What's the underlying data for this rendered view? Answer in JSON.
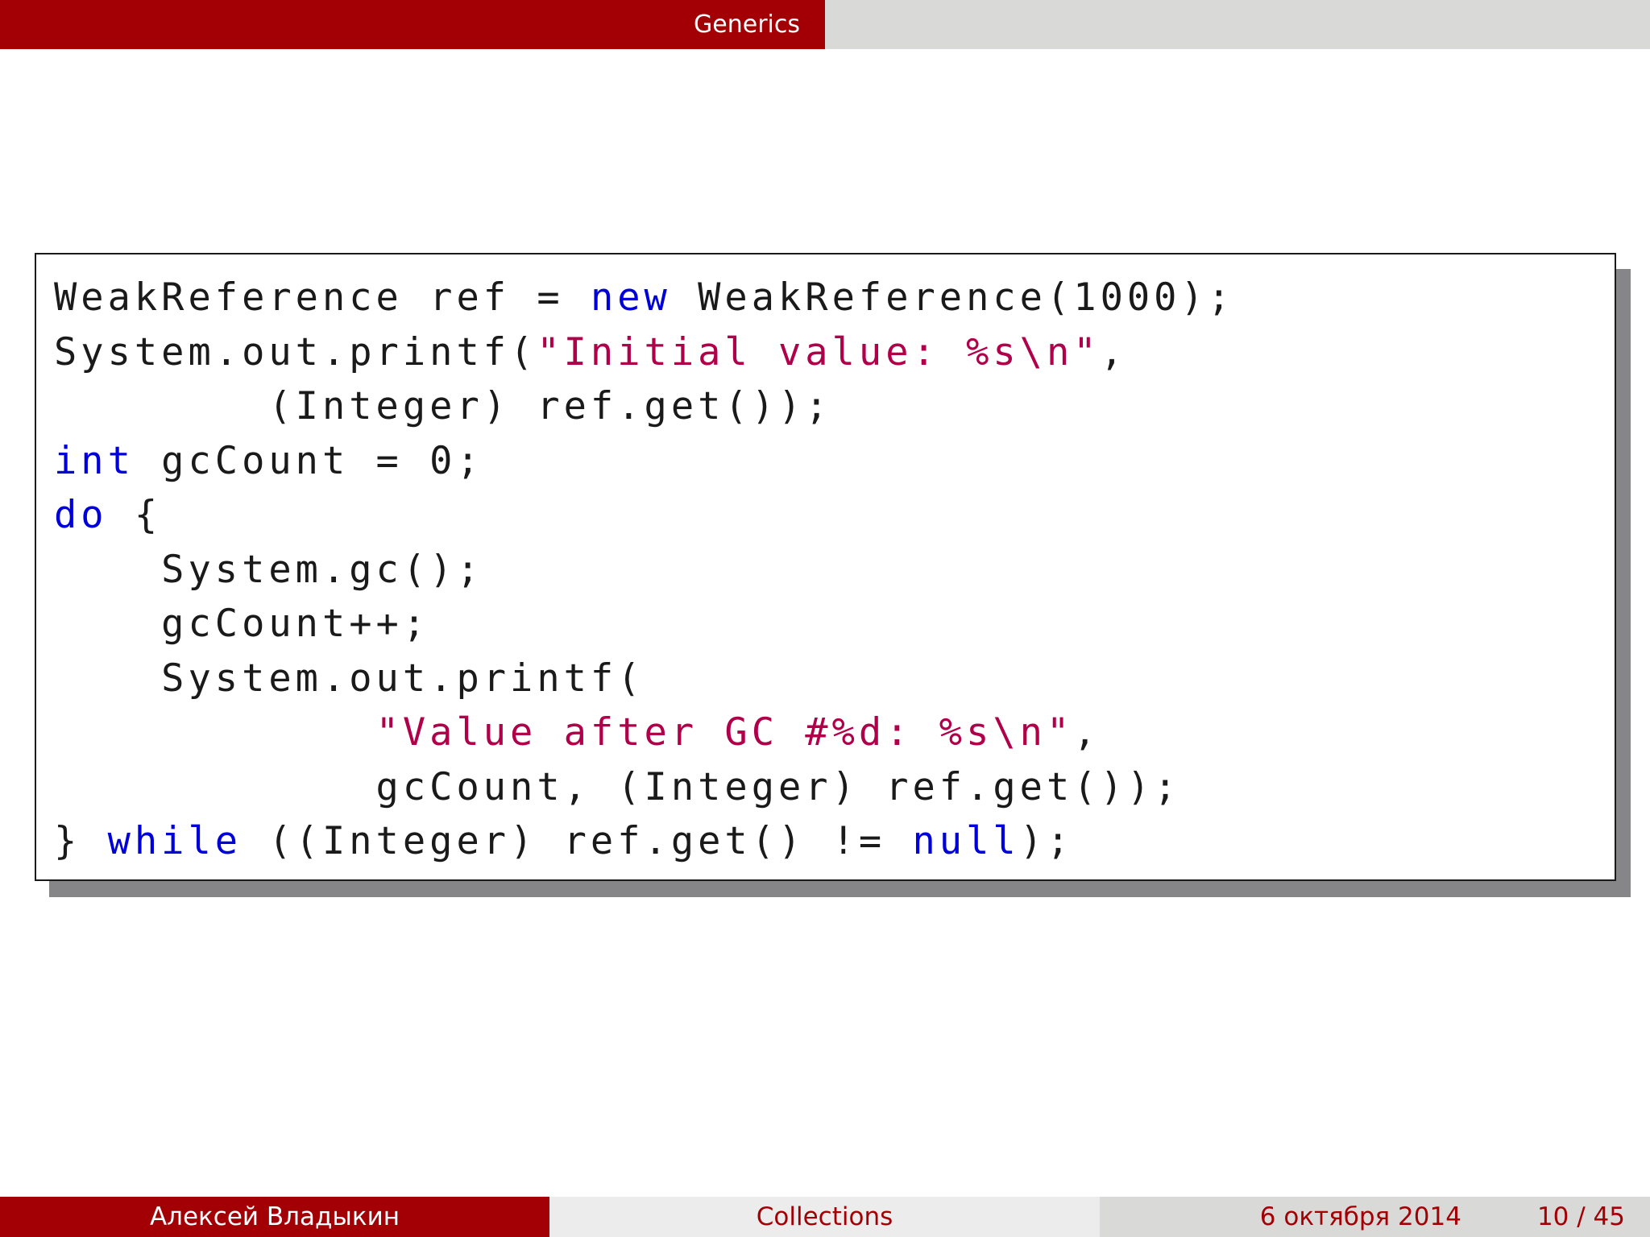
{
  "header": {
    "section_title": "Generics"
  },
  "code": {
    "lines": [
      [
        {
          "t": "WeakReference ref = ",
          "c": "plain"
        },
        {
          "t": "new",
          "c": "kw"
        },
        {
          "t": " WeakReference(1000);",
          "c": "plain"
        }
      ],
      [
        {
          "t": "System.out.printf(",
          "c": "plain"
        },
        {
          "t": "\"Initial value: %s\\n\"",
          "c": "str"
        },
        {
          "t": ",",
          "c": "plain"
        }
      ],
      [
        {
          "t": "        (Integer) ref.get());",
          "c": "plain"
        }
      ],
      [
        {
          "t": "int",
          "c": "kw"
        },
        {
          "t": " gcCount = 0;",
          "c": "plain"
        }
      ],
      [
        {
          "t": "do",
          "c": "kw"
        },
        {
          "t": " {",
          "c": "plain"
        }
      ],
      [
        {
          "t": "    System.gc();",
          "c": "plain"
        }
      ],
      [
        {
          "t": "    gcCount++;",
          "c": "plain"
        }
      ],
      [
        {
          "t": "    System.out.printf(",
          "c": "plain"
        }
      ],
      [
        {
          "t": "            ",
          "c": "plain"
        },
        {
          "t": "\"Value after GC #%d: %s\\n\"",
          "c": "str"
        },
        {
          "t": ",",
          "c": "plain"
        }
      ],
      [
        {
          "t": "            gcCount, (Integer) ref.get());",
          "c": "plain"
        }
      ],
      [
        {
          "t": "} ",
          "c": "plain"
        },
        {
          "t": "while",
          "c": "kw"
        },
        {
          "t": " ((Integer) ref.get() != ",
          "c": "plain"
        },
        {
          "t": "null",
          "c": "kw"
        },
        {
          "t": ");",
          "c": "plain"
        }
      ]
    ]
  },
  "footer": {
    "author": "Алексей Владыкин",
    "title": "Collections",
    "date": "6 октября 2014",
    "page": "10 / 45"
  },
  "colors": {
    "accent": "#a30005",
    "keyword": "#0000d8",
    "string": "#b0004a"
  }
}
